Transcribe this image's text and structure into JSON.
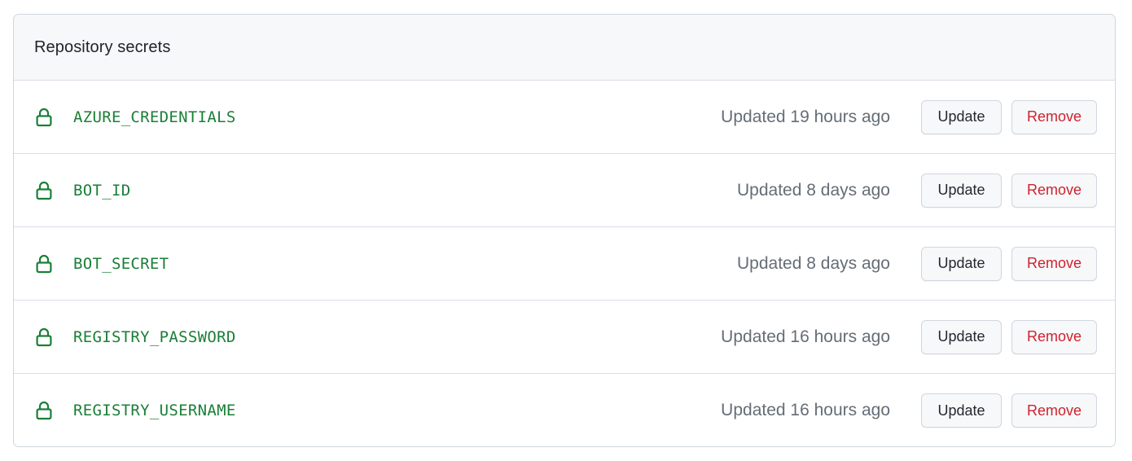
{
  "panel": {
    "title": "Repository secrets"
  },
  "secrets": [
    {
      "name": "AZURE_CREDENTIALS",
      "updated": "Updated 19 hours ago",
      "update_label": "Update",
      "remove_label": "Remove"
    },
    {
      "name": "BOT_ID",
      "updated": "Updated 8 days ago",
      "update_label": "Update",
      "remove_label": "Remove"
    },
    {
      "name": "BOT_SECRET",
      "updated": "Updated 8 days ago",
      "update_label": "Update",
      "remove_label": "Remove"
    },
    {
      "name": "REGISTRY_PASSWORD",
      "updated": "Updated 16 hours ago",
      "update_label": "Update",
      "remove_label": "Remove"
    },
    {
      "name": "REGISTRY_USERNAME",
      "updated": "Updated 16 hours ago",
      "update_label": "Update",
      "remove_label": "Remove"
    }
  ],
  "icons": {
    "secret": "lock-icon"
  },
  "colors": {
    "secret_name": "#1a7f37",
    "lock_icon": "#1a7f37",
    "remove_text": "#cf222e",
    "muted_text": "#656d76",
    "header_bg": "#f6f8fa",
    "border": "#d0d7de"
  }
}
